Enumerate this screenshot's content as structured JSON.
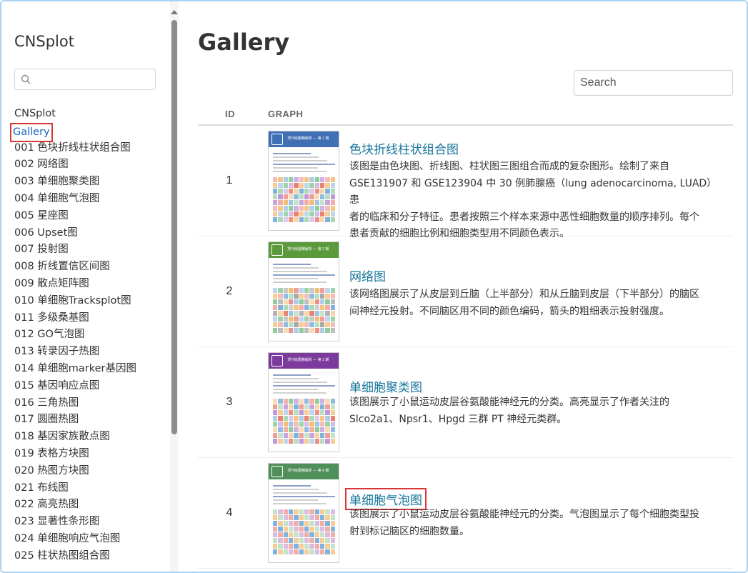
{
  "sidebar": {
    "title": "CNSplot",
    "search": {
      "placeholder": "",
      "value": ""
    },
    "items": [
      {
        "label": "CNSplot",
        "active": false
      },
      {
        "label": "Gallery",
        "active": true
      },
      {
        "label": "001 色块折线柱状组合图"
      },
      {
        "label": "002 网络图"
      },
      {
        "label": "003 单细胞聚类图"
      },
      {
        "label": "004 单细胞气泡图"
      },
      {
        "label": "005 星座图"
      },
      {
        "label": "006 Upset图"
      },
      {
        "label": "007 投射图"
      },
      {
        "label": "008 折线置信区间图"
      },
      {
        "label": "009 散点矩阵图"
      },
      {
        "label": "010 单细胞Tracksplot图"
      },
      {
        "label": "011 多级桑基图"
      },
      {
        "label": "012 GO气泡图"
      },
      {
        "label": "013 转录因子热图"
      },
      {
        "label": "014 单细胞marker基因图"
      },
      {
        "label": "015 基因响应点图"
      },
      {
        "label": "016 三角热图"
      },
      {
        "label": "017 圆圈热图"
      },
      {
        "label": "018 基因家族散点图"
      },
      {
        "label": "019 表格方块图"
      },
      {
        "label": "020 热图方块图"
      },
      {
        "label": "021 布线图"
      },
      {
        "label": "022 高亮热图"
      },
      {
        "label": "023 显著性条形图"
      },
      {
        "label": "024 单细胞响应气泡图"
      },
      {
        "label": "025 柱状热图组合图"
      }
    ]
  },
  "main": {
    "title": "Gallery",
    "search_placeholder": "Search",
    "columns": {
      "id": "ID",
      "graph": "GRAPH"
    },
    "rows": [
      {
        "id": "1",
        "title": "色块折线柱状组合图",
        "desc_lines": [
          "该图是由色块图、折线图、柱状图三图组合而成的复杂图形。绘制了来自",
          "GSE131907 和 GSE123904 中 30 例肺腺癌（lung adenocarcinoma, LUAD）患",
          "者的临床和分子特征。患者按照三个样本来源中恶性细胞数量的顺序排列。每个",
          "患者贡献的细胞比例和细胞类型用不同颜色表示。"
        ],
        "thumb_label": "顶刊绘图精解析 — 第 1 期",
        "thumb_color": "#3f6fb5"
      },
      {
        "id": "2",
        "title": "网络图",
        "desc_lines": [
          "该网络图展示了从皮层到丘脑（上半部分）和从丘脑到皮层（下半部分）的脑区",
          "间神经元投射。不同脑区用不同的颜色编码，箭头的粗细表示投射强度。"
        ],
        "thumb_label": "顶刊绘图精解析 — 第 2 期",
        "thumb_color": "#5a9a3a"
      },
      {
        "id": "3",
        "title": "单细胞聚类图",
        "desc_lines": [
          "该图展示了小鼠运动皮层谷氨酸能神经元的分类。高亮显示了作者关注的",
          "Slco2a1、Npsr1、Hpgd 三群 PT 神经元类群。"
        ],
        "thumb_label": "顶刊绘图精解析 — 第 3 期",
        "thumb_color": "#7b3a9c"
      },
      {
        "id": "4",
        "title": "单细胞气泡图",
        "desc_lines": [
          "该图展示了小鼠运动皮层谷氨酸能神经元的分类。气泡图显示了每个细胞类型投",
          "射到标记脑区的细胞数量。"
        ],
        "thumb_label": "顶刊绘图精解析 — 第 4 期",
        "thumb_color": "#4f8f5a"
      }
    ]
  }
}
